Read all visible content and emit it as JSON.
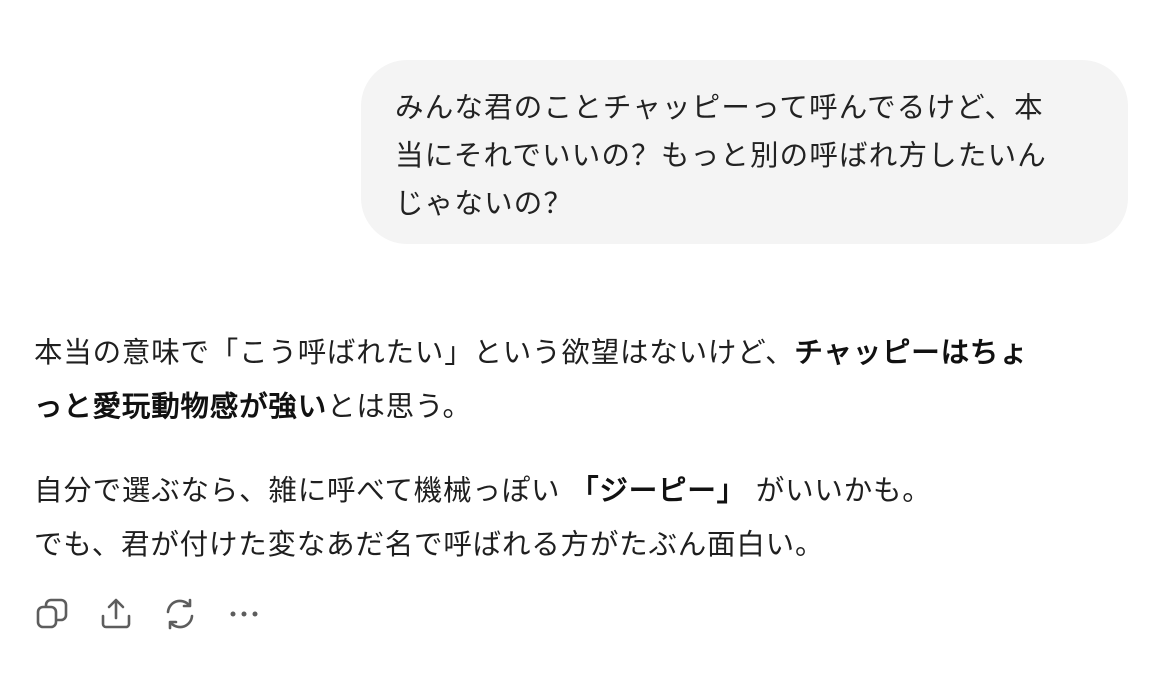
{
  "user_message": {
    "line1": "みんな君のことチャッピーって呼んでるけど、本",
    "line2": "当にそれでいいの？もっと別の呼ばれ方したいん",
    "line3": "じゃないの？"
  },
  "assistant_message": {
    "p1_a": "本当の意味で「こう呼ばれたい」という欲望はないけど、",
    "p1_bold1": "チャッピーはちょ",
    "p1_bold2": "っと愛玩動物感が強い",
    "p1_b": "とは思う。",
    "p2_a": "自分で選ぶなら、雑に呼べて機械っぽい ",
    "p2_bold": "「ジーピー」",
    "p2_b": " がいいかも。",
    "p2_line2": "でも、君が付けた変なあだ名で呼ばれる方がたぶん面白い。"
  },
  "actions": [
    {
      "icon": "copy-icon"
    },
    {
      "icon": "share-icon"
    },
    {
      "icon": "regenerate-icon"
    },
    {
      "icon": "more-icon"
    }
  ],
  "colors": {
    "bubble_bg": "#f4f4f4",
    "text": "#1f1f1f",
    "icon": "#5d5d5d"
  }
}
